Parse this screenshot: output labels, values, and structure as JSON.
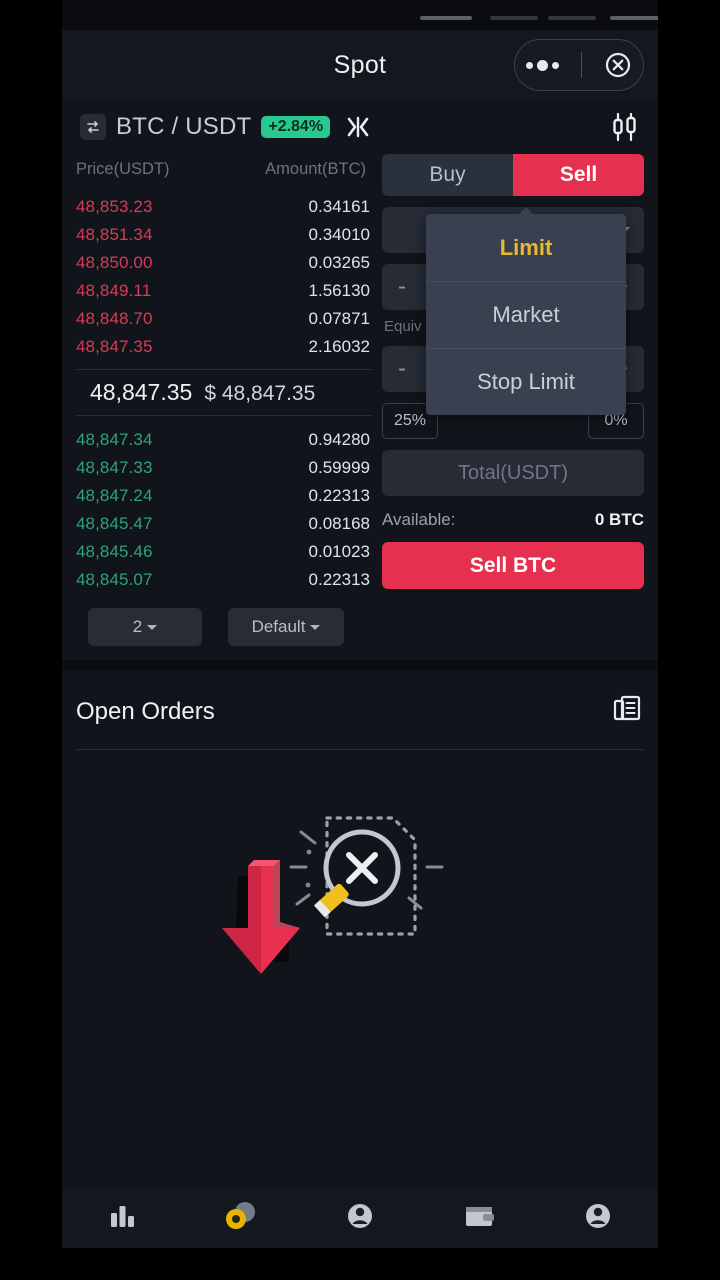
{
  "app": {
    "title": "Spot",
    "accent_red": "#e5304f",
    "accent_green": "#27c98f",
    "accent_gold": "#e8b931",
    "bg": "#11141a"
  },
  "titlebar": {
    "title": "Spot",
    "more_icon": "more-dots-icon",
    "close_icon": "close-circle-icon"
  },
  "pair": {
    "swap_icon": "swap-arrows-icon",
    "name": "BTC / USDT",
    "change": "+2.84%",
    "depth_icon": "depth-collapse-icon",
    "chart_icon": "candlestick-chart-icon"
  },
  "orderbook": {
    "col_price": "Price(USDT)",
    "col_amount": "Amount(BTC)",
    "asks": [
      {
        "price": "48,853.23",
        "amount": "0.34161"
      },
      {
        "price": "48,851.34",
        "amount": "0.34010"
      },
      {
        "price": "48,850.00",
        "amount": "0.03265"
      },
      {
        "price": "48,849.11",
        "amount": "1.56130"
      },
      {
        "price": "48,848.70",
        "amount": "0.07871"
      },
      {
        "price": "48,847.35",
        "amount": "2.16032"
      }
    ],
    "last_price": "48,847.35",
    "last_price_fiat": "$ 48,847.35",
    "bids": [
      {
        "price": "48,847.34",
        "amount": "0.94280"
      },
      {
        "price": "48,847.33",
        "amount": "0.59999"
      },
      {
        "price": "48,847.24",
        "amount": "0.22313"
      },
      {
        "price": "48,845.47",
        "amount": "0.08168"
      },
      {
        "price": "48,845.46",
        "amount": "0.01023"
      },
      {
        "price": "48,845.07",
        "amount": "0.22313"
      }
    ],
    "decimals_selector": "2",
    "display_selector": "Default"
  },
  "orderform": {
    "buy_label": "Buy",
    "sell_label": "Sell",
    "order_type": "Limit",
    "price_minus": "-",
    "price_plus": "+",
    "equiv_label": "Equiv",
    "amount_minus": "-",
    "amount_plus": "+",
    "pct_left": "25%",
    "pct_right": "0%",
    "total_placeholder": "Total(USDT)",
    "available_label": "Available:",
    "available_value": "0 BTC",
    "submit_label": "Sell BTC"
  },
  "type_dropdown": {
    "options": [
      "Limit",
      "Market",
      "Stop Limit"
    ],
    "selected": "Limit"
  },
  "open_orders": {
    "title": "Open Orders",
    "list_icon": "order-history-icon",
    "empty_icon": "no-records-magnifier-icon",
    "annotation_icon": "red-down-arrow-icon"
  },
  "bottom_nav": {
    "items": [
      {
        "name": "markets-tab",
        "icon": "bar-chart-icon",
        "active": false
      },
      {
        "name": "trade-tab",
        "icon": "coins-icon",
        "active": true
      },
      {
        "name": "futures-tab",
        "icon": "person-circle-icon",
        "active": false
      },
      {
        "name": "wallet-tab",
        "icon": "wallet-icon",
        "active": false
      },
      {
        "name": "profile-tab",
        "icon": "account-icon",
        "active": false
      }
    ]
  }
}
